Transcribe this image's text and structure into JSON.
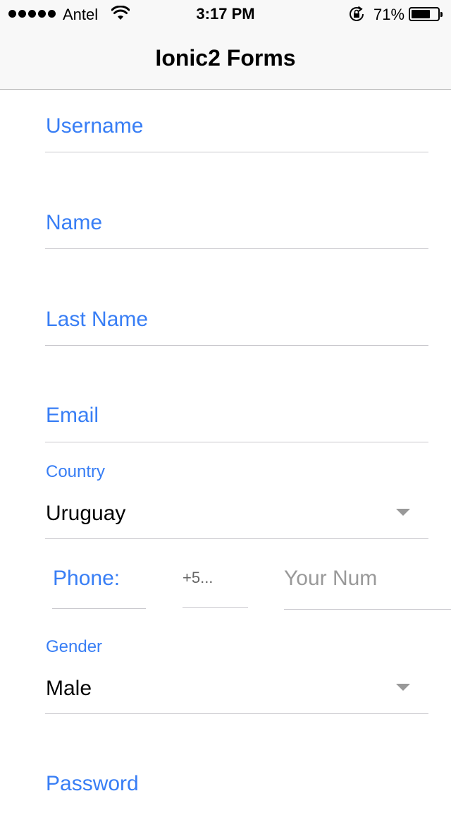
{
  "status_bar": {
    "carrier": "Antel",
    "time": "3:17 PM",
    "battery_percent": "71%",
    "battery_level": 0.71,
    "icons": [
      "signal-dots-icon",
      "wifi-icon",
      "rotation-lock-icon",
      "battery-icon"
    ]
  },
  "header": {
    "title": "Ionic2 Forms"
  },
  "form": {
    "username_label": "Username",
    "name_label": "Name",
    "last_name_label": "Last Name",
    "email_label": "Email",
    "country": {
      "label": "Country",
      "selected": "Uruguay"
    },
    "phone": {
      "label": "Phone:",
      "code": "+5...",
      "number_placeholder": "Your Num"
    },
    "gender": {
      "label": "Gender",
      "selected": "Male"
    },
    "password_label": "Password"
  },
  "colors": {
    "accent": "#387ef5",
    "header_bg": "#f8f8f8",
    "divider": "#c8c7cc",
    "placeholder": "#999999"
  }
}
